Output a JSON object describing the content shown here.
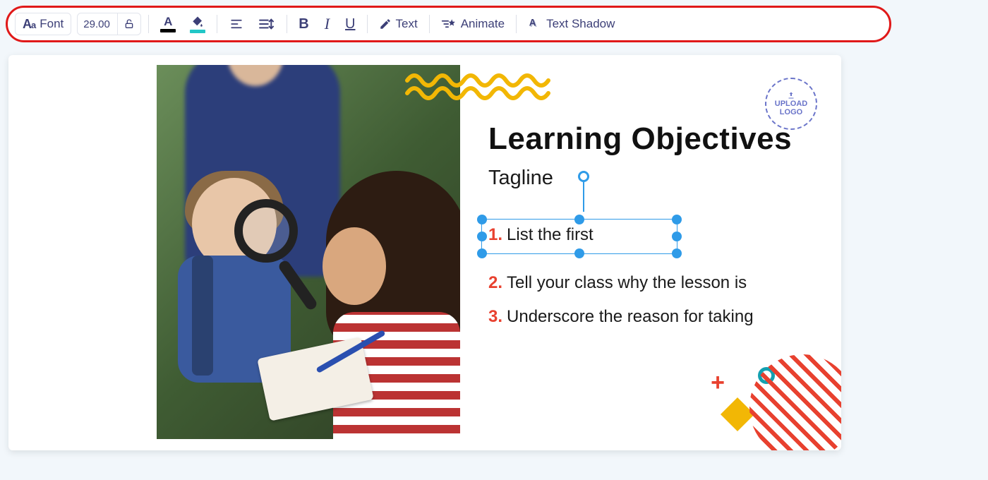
{
  "toolbar": {
    "font_label": "Font",
    "font_size": "29.00",
    "text_color": "#000000",
    "highlight_color": "#22c7c7",
    "text_label": "Text",
    "animate_label": "Animate",
    "shadow_label": "Text Shadow"
  },
  "slide": {
    "title": "Learning Objectives",
    "tagline": "Tagline",
    "items": [
      {
        "num": "1.",
        "text": "List the first"
      },
      {
        "num": "2.",
        "text": "Tell your class why the lesson is"
      },
      {
        "num": "3.",
        "text": "Underscore the reason for taking"
      }
    ],
    "logo_line1": "UPLOAD",
    "logo_line2": "LOGO"
  }
}
